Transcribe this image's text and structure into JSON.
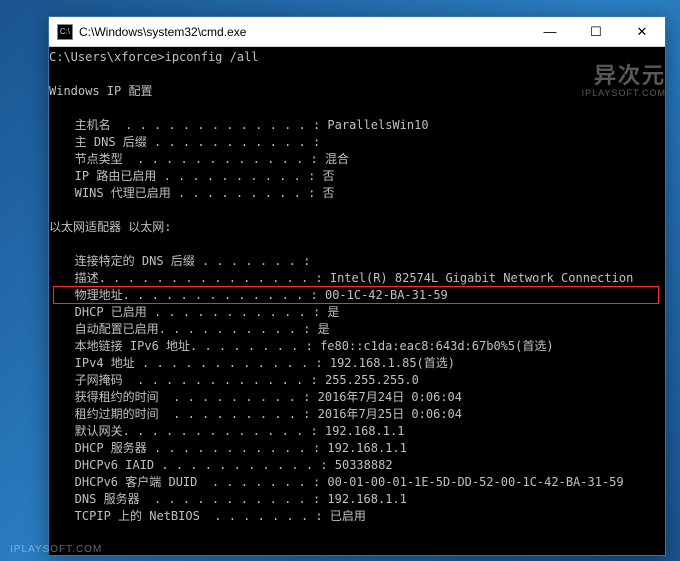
{
  "window": {
    "title": "C:\\Windows\\system32\\cmd.exe",
    "controls": {
      "min": "—",
      "max": "☐",
      "close": "✕"
    }
  },
  "prompt": {
    "path": "C:\\Users\\xforce>",
    "command": "ipconfig /all"
  },
  "sections": {
    "ipconfig_header": "Windows IP 配置",
    "host": [
      {
        "label": "   主机名  . . . . . . . . . . . . . ",
        "value": "ParallelsWin10"
      },
      {
        "label": "   主 DNS 后缀 . . . . . . . . . . . ",
        "value": ""
      },
      {
        "label": "   节点类型  . . . . . . . . . . . . ",
        "value": "混合"
      },
      {
        "label": "   IP 路由已启用 . . . . . . . . . . ",
        "value": "否"
      },
      {
        "label": "   WINS 代理已启用 . . . . . . . . . ",
        "value": "否"
      }
    ],
    "adapter_header": "以太网适配器 以太网:",
    "adapter": [
      {
        "label": "   连接特定的 DNS 后缀 . . . . . . . ",
        "value": ""
      },
      {
        "label": "   描述. . . . . . . . . . . . . . . ",
        "value": "Intel(R) 82574L Gigabit Network Connection"
      },
      {
        "label": "   物理地址. . . . . . . . . . . . . ",
        "value": "00-1C-42-BA-31-59",
        "hl": true
      },
      {
        "label": "   DHCP 已启用 . . . . . . . . . . . ",
        "value": "是"
      },
      {
        "label": "   自动配置已启用. . . . . . . . . . ",
        "value": "是"
      },
      {
        "label": "   本地链接 IPv6 地址. . . . . . . . ",
        "value": "fe80::c1da:eac8:643d:67b0%5(首选)"
      },
      {
        "label": "   IPv4 地址 . . . . . . . . . . . . ",
        "value": "192.168.1.85(首选)"
      },
      {
        "label": "   子网掩码  . . . . . . . . . . . . ",
        "value": "255.255.255.0"
      },
      {
        "label": "   获得租约的时间  . . . . . . . . . ",
        "value": "2016年7月24日 0:06:04"
      },
      {
        "label": "   租约过期的时间  . . . . . . . . . ",
        "value": "2016年7月25日 0:06:04"
      },
      {
        "label": "   默认网关. . . . . . . . . . . . . ",
        "value": "192.168.1.1"
      },
      {
        "label": "   DHCP 服务器 . . . . . . . . . . . ",
        "value": "192.168.1.1"
      },
      {
        "label": "   DHCPv6 IAID . . . . . . . . . . . ",
        "value": "50338882"
      },
      {
        "label": "   DHCPv6 客户端 DUID  . . . . . . . ",
        "value": "00-01-00-01-1E-5D-DD-52-00-1C-42-BA-31-59"
      },
      {
        "label": "   DNS 服务器  . . . . . . . . . . . ",
        "value": "192.168.1.1"
      },
      {
        "label": "   TCPIP 上的 NetBIOS  . . . . . . . ",
        "value": "已启用"
      }
    ]
  },
  "watermark": {
    "big": "异次元",
    "small": "IPLAYSOFT.COM",
    "bottom": "IPLAYSOFT.COM"
  },
  "colors": {
    "highlight_border": "#ff2a2a",
    "console_bg": "#000000",
    "console_fg": "#c0c0c0"
  }
}
